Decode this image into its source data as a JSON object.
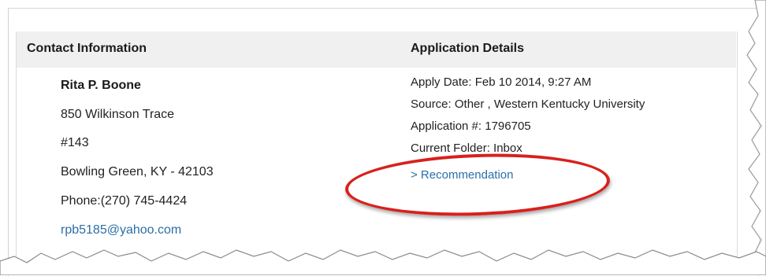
{
  "contact": {
    "title": "Contact Information",
    "name": "Rita P. Boone",
    "address1": "850 Wilkinson Trace",
    "address2": "#143",
    "city_state_zip": "Bowling Green, KY - 42103",
    "phone": "Phone:(270) 745-4424",
    "email": "rpb5185@yahoo.com"
  },
  "application": {
    "title": "Application Details",
    "apply_date": "Apply Date: Feb 10 2014, 9:27 AM",
    "source": "Source: Other , Western Kentucky University",
    "application_number": "Application #: 1796705",
    "current_folder": "Current Folder: Inbox",
    "recommendation_link": "> Recommendation"
  },
  "colors": {
    "link": "#2a6fa8",
    "highlight": "#d8201c",
    "header_bg": "#f0f0f0"
  }
}
